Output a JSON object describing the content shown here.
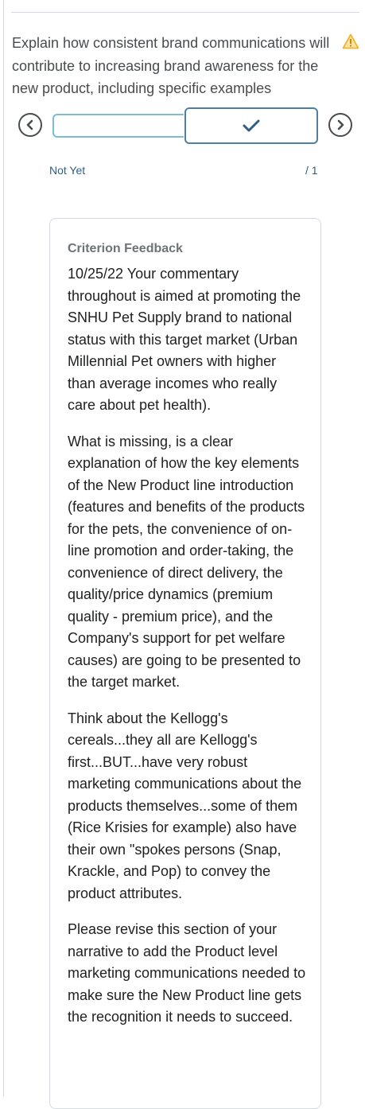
{
  "criterion": {
    "description": "Explain how consistent brand communications will contribute to increasing brand awareness for the new product, including specific examples"
  },
  "icons": {
    "warning": "warning-triangle-icon",
    "prev": "chevron-left-circle-icon",
    "next": "chevron-right-circle-icon",
    "check": "checkmark-icon"
  },
  "colors": {
    "warning": "#f5c35b",
    "selected_border": "#4f7fa6",
    "level_border": "#7dbbd6",
    "check": "#2f5d87",
    "link_text": "#2f5d87"
  },
  "assessment": {
    "level_name": "Not Yet",
    "score": "/ 1"
  },
  "feedback": {
    "title": "Criterion Feedback",
    "paragraphs": [
      "10/25/22  Your commentary throughout is aimed at promoting the SNHU Pet Supply brand to national status with this target market (Urban Millennial Pet owners with higher than average incomes who really care about pet health).",
      "What is missing, is a clear explanation of how the key elements of the New Product line introduction (features and benefits of the products for the pets, the convenience of on-line promotion and order-taking, the convenience of direct delivery, the quality/price dynamics (premium quality - premium price), and the Company's support for pet welfare causes) are going to be presented to the target market.",
      "Think about the Kellogg's cereals...they all are Kellogg's first...BUT...have very robust marketing communications about the products themselves...some of them (Rice Krisies for example) also have their own \"spokes persons (Snap, Krackle, and Pop) to convey the product attributes.",
      "Please revise this section of your narrative to add the Product level marketing communications needed to make sure the New Product line gets the recognition it needs to succeed."
    ]
  }
}
